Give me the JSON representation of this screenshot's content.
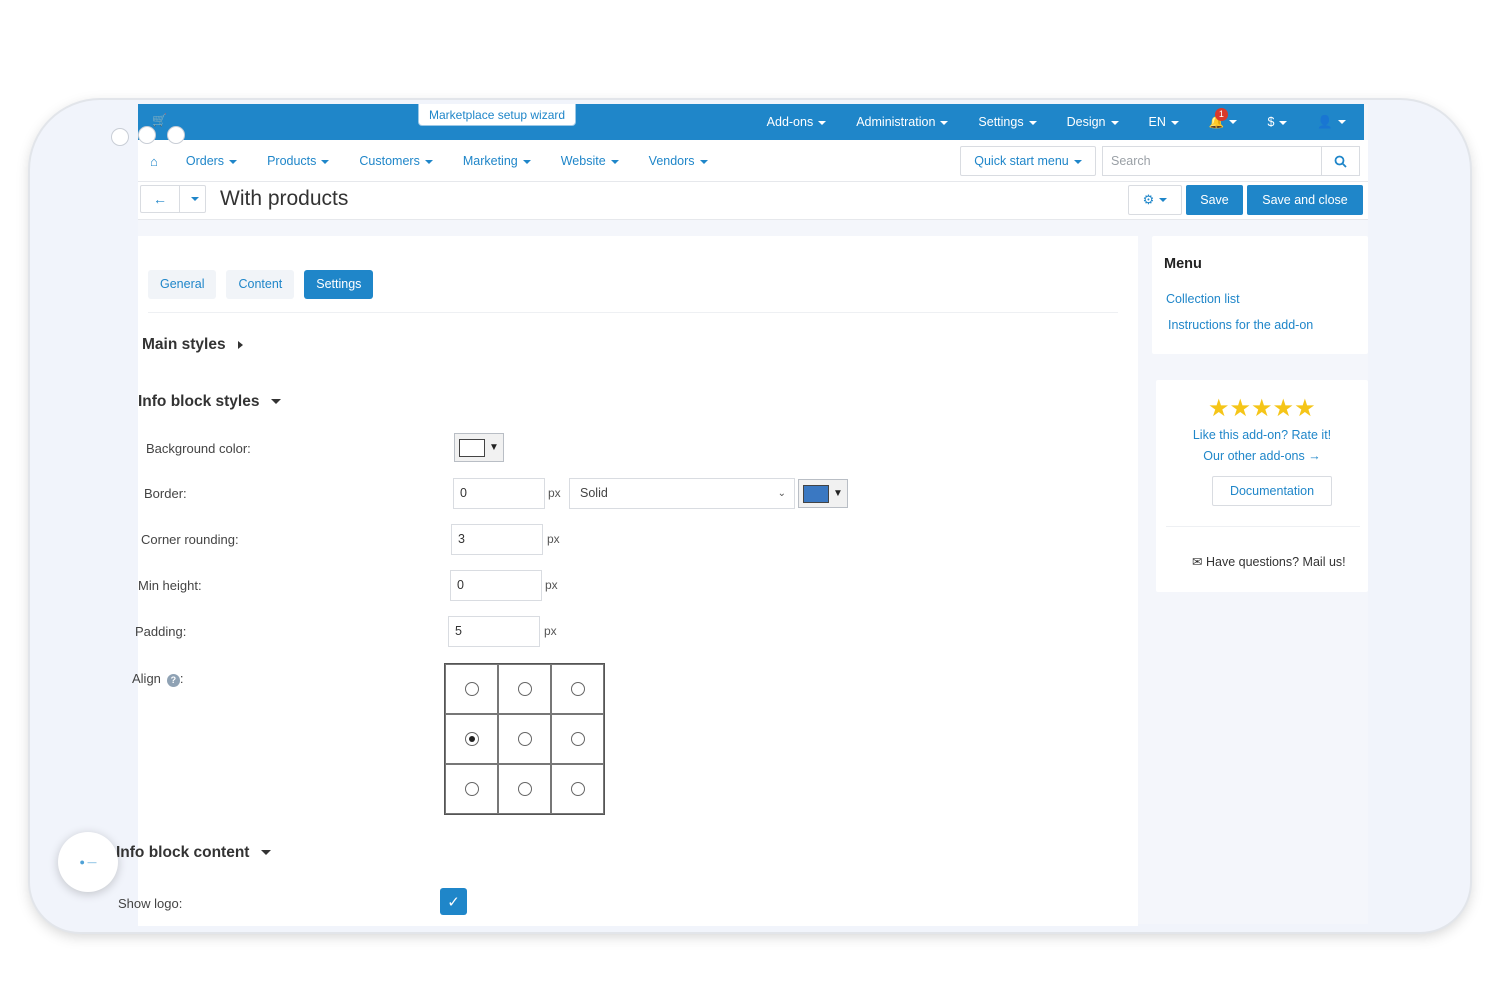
{
  "topbar": {
    "wizard_label": "Marketplace setup wizard",
    "items": [
      "Add-ons",
      "Administration",
      "Settings",
      "Design",
      "EN"
    ],
    "notifications_count": "1",
    "currency": "$"
  },
  "mainnav": {
    "items": [
      "Orders",
      "Products",
      "Customers",
      "Marketing",
      "Website",
      "Vendors"
    ],
    "quick_start": "Quick start menu",
    "search_placeholder": "Search"
  },
  "titlebar": {
    "title": "With products",
    "save": "Save",
    "save_close": "Save and close"
  },
  "tabs": [
    "General",
    "Content",
    "Settings"
  ],
  "sections": {
    "main_styles": "Main styles",
    "info_block_styles": "Info block styles",
    "info_block_content": "Info block content"
  },
  "fields": {
    "background_color": {
      "label": "Background color:",
      "color": "#ffffff"
    },
    "border": {
      "label": "Border:",
      "value": "0",
      "unit": "px",
      "style": "Solid",
      "color": "#3a78c2"
    },
    "corner_rounding": {
      "label": "Corner rounding:",
      "value": "3",
      "unit": "px"
    },
    "min_height": {
      "label": "Min height:",
      "value": "0",
      "unit": "px"
    },
    "padding": {
      "label": "Padding:",
      "value": "5",
      "unit": "px"
    },
    "align": {
      "label": "Align",
      "selected_index": 3
    },
    "show_logo": {
      "label": "Show logo:",
      "checked": true
    }
  },
  "sidebar": {
    "menu_title": "Menu",
    "links": [
      "Collection list",
      "Instructions for the add-on"
    ],
    "rate_text": "Like this add-on? Rate it!",
    "other_addons": "Our other add-ons →",
    "documentation": "Documentation",
    "mail_us": "Have questions? Mail us!"
  },
  "colors": {
    "accent": "#1f86c9"
  }
}
